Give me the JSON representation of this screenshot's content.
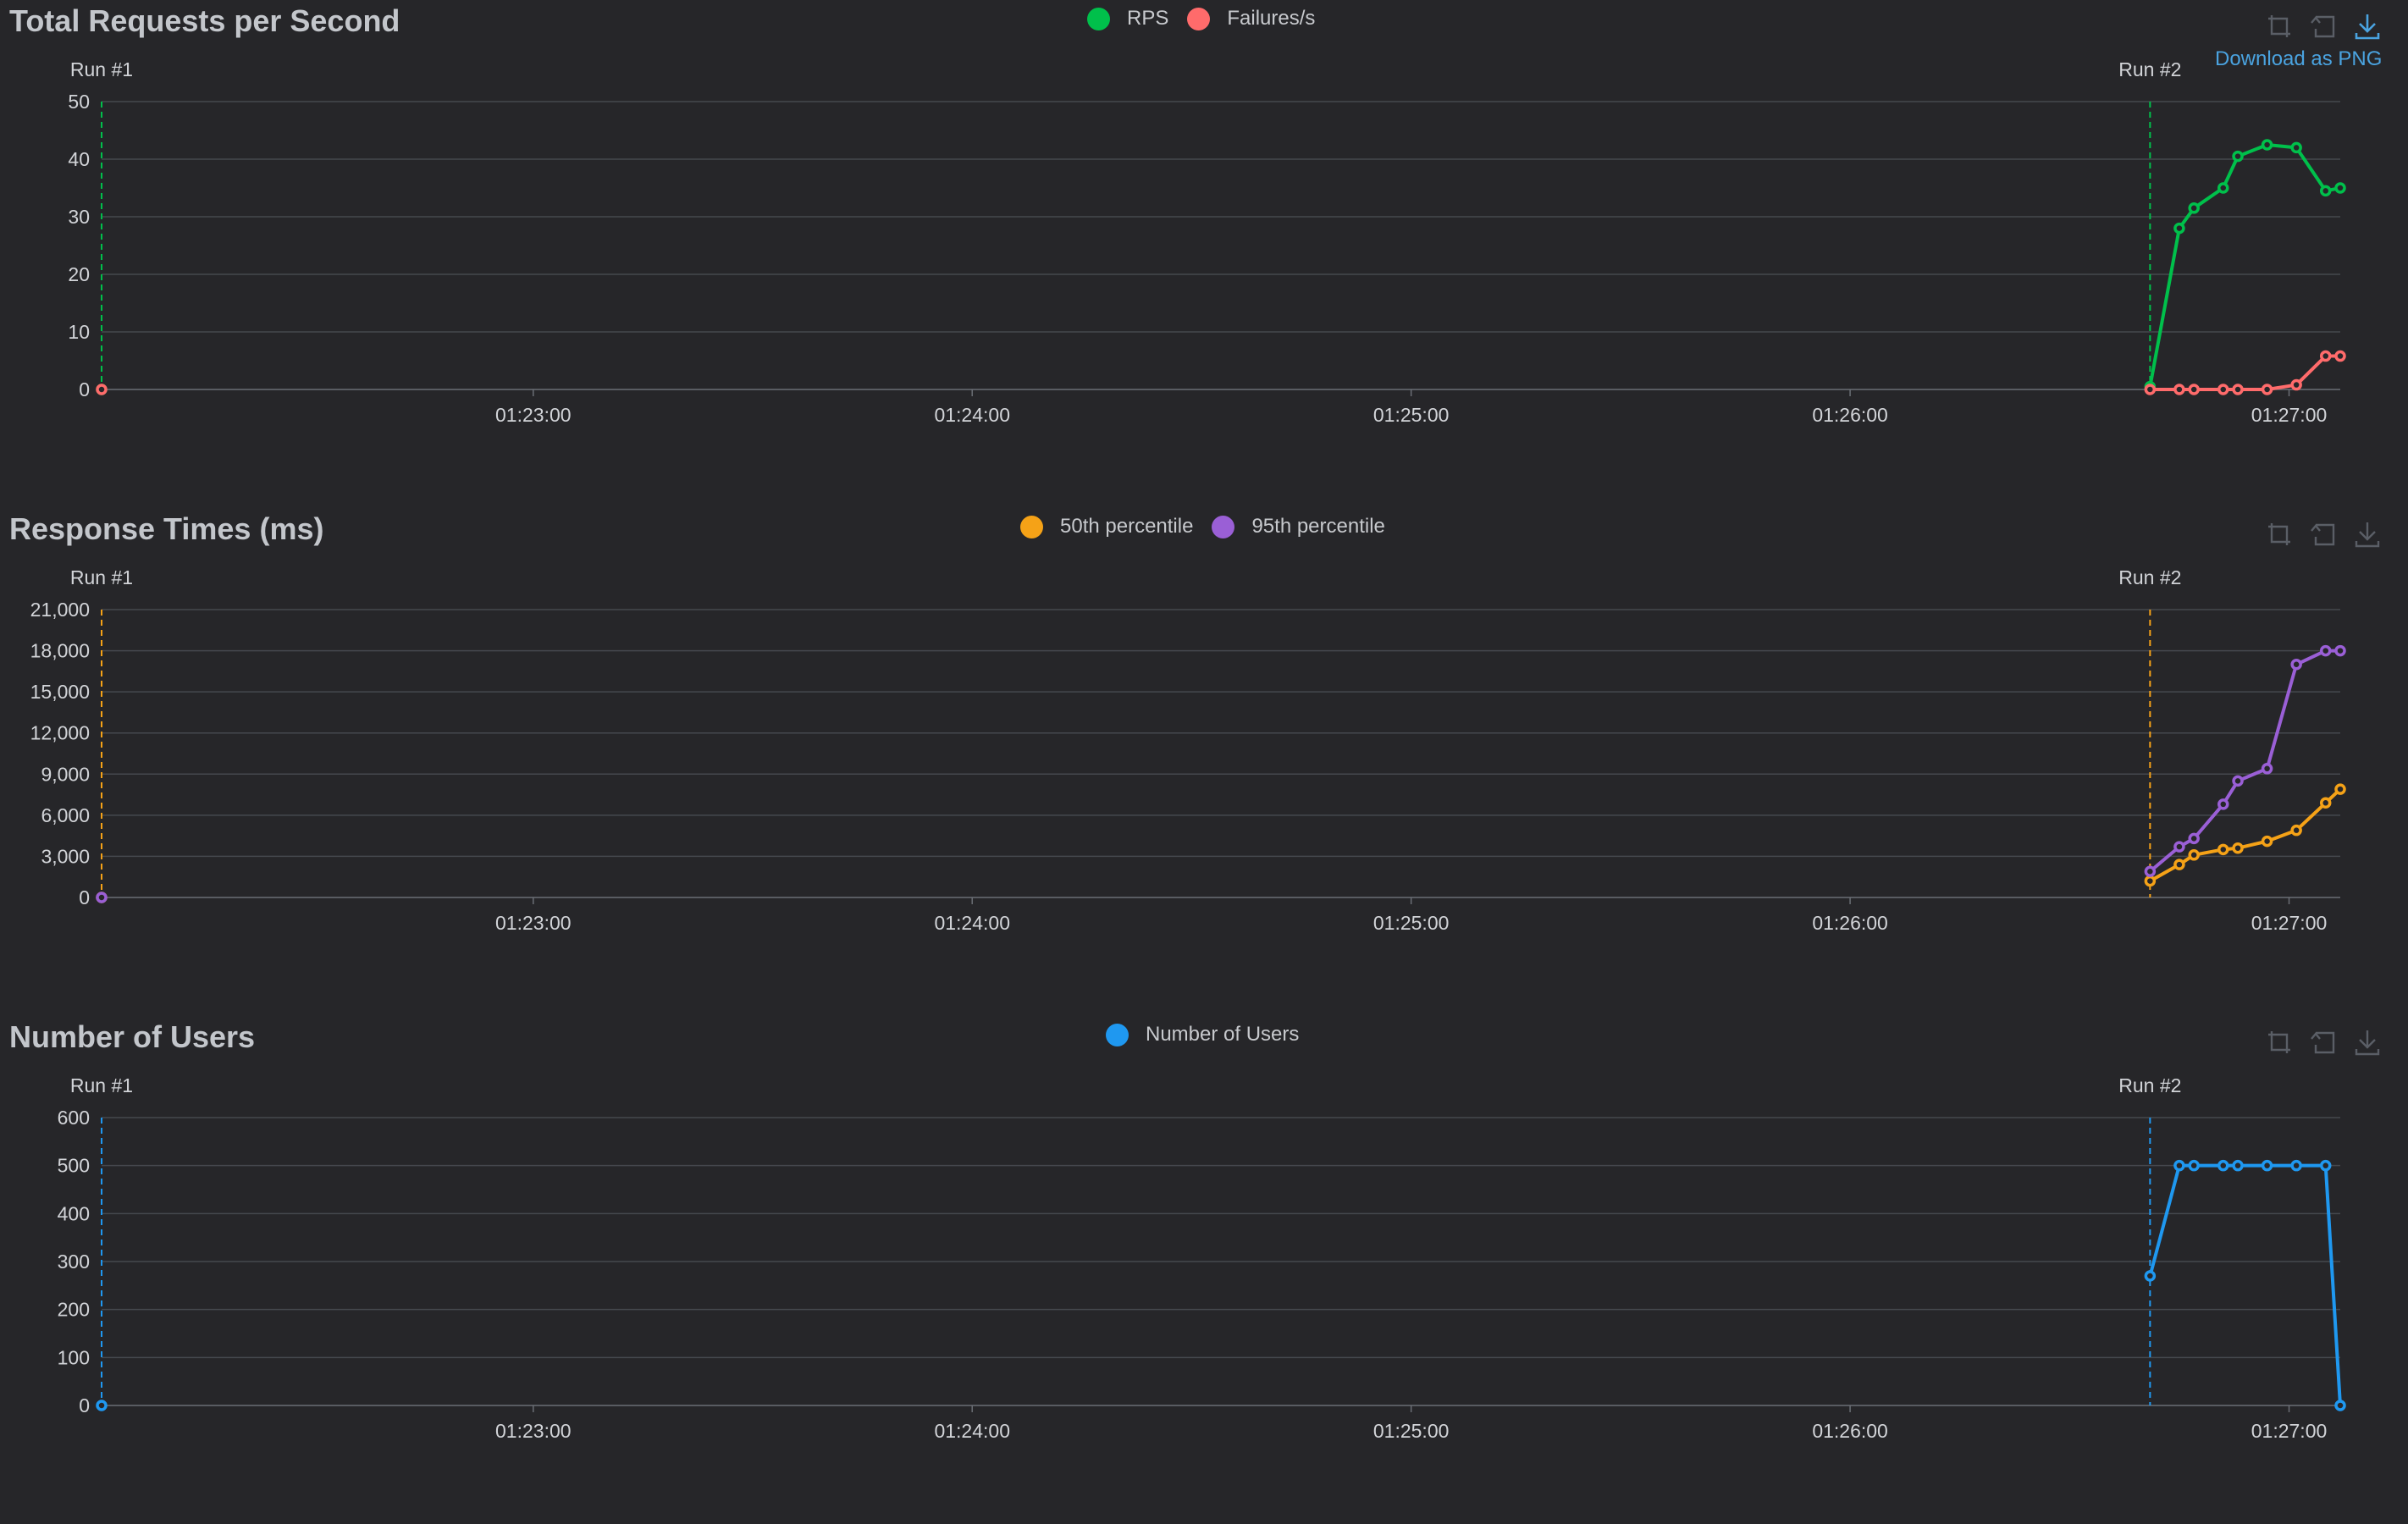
{
  "x_tick_labels": [
    "01:23:00",
    "01:24:00",
    "01:25:00",
    "01:26:00",
    "01:27:00"
  ],
  "download_tooltip": "Download as PNG",
  "charts": [
    {
      "id": "rps",
      "title": "Total Requests per Second",
      "legend": [
        {
          "name": "RPS",
          "color": "#00c04b"
        },
        {
          "name": "Failures/s",
          "color": "#ff6b6b"
        }
      ],
      "mark_lines": [
        "Run #1",
        "Run #2"
      ],
      "toolbox_icons": [
        "zoom-icon",
        "restore-icon",
        "download-icon"
      ]
    },
    {
      "id": "response",
      "title": "Response Times (ms)",
      "legend": [
        {
          "name": "50th percentile",
          "color": "#f5a217"
        },
        {
          "name": "95th percentile",
          "color": "#9a5fd6"
        }
      ],
      "mark_lines": [
        "Run #1",
        "Run #2"
      ],
      "toolbox_icons": [
        "zoom-icon",
        "restore-icon",
        "download-icon"
      ]
    },
    {
      "id": "users",
      "title": "Number of Users",
      "legend": [
        {
          "name": "Number of Users",
          "color": "#1f98f0"
        }
      ],
      "mark_lines": [
        "Run #1",
        "Run #2"
      ],
      "toolbox_icons": [
        "zoom-icon",
        "restore-icon",
        "download-icon"
      ]
    }
  ],
  "chart_data": [
    {
      "type": "line",
      "title": "Total Requests per Second",
      "xlabel": "",
      "ylabel": "",
      "x_ticks": [
        "01:23:00",
        "01:24:00",
        "01:25:00",
        "01:26:00",
        "01:27:00"
      ],
      "ylim": [
        0,
        50
      ],
      "y_ticks": [
        0,
        10,
        20,
        30,
        40,
        50
      ],
      "y_tick_labels": [
        "0",
        "10",
        "20",
        "30",
        "40",
        "50"
      ],
      "grid": true,
      "legend_position": "top-center",
      "run_markers": [
        {
          "label": "Run #1",
          "x": "01:22:01"
        },
        {
          "label": "Run #2",
          "x": "01:26:41"
        }
      ],
      "series": [
        {
          "name": "RPS",
          "color": "#00c04b",
          "x": [
            "01:22:01",
            "01:26:41",
            "01:26:45",
            "01:26:47",
            "01:26:51",
            "01:26:53",
            "01:26:57",
            "01:27:01",
            "01:27:05",
            "01:27:07"
          ],
          "values": [
            0,
            0.5,
            28,
            31.5,
            35,
            40.5,
            42.5,
            42,
            34.5,
            35
          ]
        },
        {
          "name": "Failures/s",
          "color": "#ff6b6b",
          "x": [
            "01:22:01",
            "01:26:41",
            "01:26:45",
            "01:26:47",
            "01:26:51",
            "01:26:53",
            "01:26:57",
            "01:27:01",
            "01:27:05",
            "01:27:07"
          ],
          "values": [
            0,
            0,
            0,
            0,
            0,
            0,
            0,
            0.8,
            5.8,
            5.8
          ]
        }
      ]
    },
    {
      "type": "line",
      "title": "Response Times (ms)",
      "xlabel": "",
      "ylabel": "",
      "x_ticks": [
        "01:23:00",
        "01:24:00",
        "01:25:00",
        "01:26:00",
        "01:27:00"
      ],
      "ylim": [
        0,
        21000
      ],
      "y_ticks": [
        0,
        3000,
        6000,
        9000,
        12000,
        15000,
        18000,
        21000
      ],
      "y_tick_labels": [
        "0",
        "3,000",
        "6,000",
        "9,000",
        "12,000",
        "15,000",
        "18,000",
        "21,000"
      ],
      "grid": true,
      "legend_position": "top-center",
      "run_markers": [
        {
          "label": "Run #1",
          "x": "01:22:01"
        },
        {
          "label": "Run #2",
          "x": "01:26:41"
        }
      ],
      "series": [
        {
          "name": "50th percentile",
          "color": "#f5a217",
          "x": [
            "01:22:01",
            "01:26:41",
            "01:26:45",
            "01:26:47",
            "01:26:51",
            "01:26:53",
            "01:26:57",
            "01:27:01",
            "01:27:05",
            "01:27:07"
          ],
          "values": [
            0,
            1200,
            2400,
            3100,
            3500,
            3600,
            4100,
            4900,
            6900,
            7900
          ]
        },
        {
          "name": "95th percentile",
          "color": "#9a5fd6",
          "x": [
            "01:22:01",
            "01:26:41",
            "01:26:45",
            "01:26:47",
            "01:26:51",
            "01:26:53",
            "01:26:57",
            "01:27:01",
            "01:27:05",
            "01:27:07"
          ],
          "values": [
            0,
            1900,
            3700,
            4300,
            6800,
            8500,
            9400,
            17000,
            18000,
            18000
          ]
        }
      ]
    },
    {
      "type": "line",
      "title": "Number of Users",
      "xlabel": "",
      "ylabel": "",
      "x_ticks": [
        "01:23:00",
        "01:24:00",
        "01:25:00",
        "01:26:00",
        "01:27:00"
      ],
      "ylim": [
        0,
        600
      ],
      "y_ticks": [
        0,
        100,
        200,
        300,
        400,
        500,
        600
      ],
      "y_tick_labels": [
        "0",
        "100",
        "200",
        "300",
        "400",
        "500",
        "600"
      ],
      "grid": true,
      "legend_position": "top-center",
      "run_markers": [
        {
          "label": "Run #1",
          "x": "01:22:01"
        },
        {
          "label": "Run #2",
          "x": "01:26:41"
        }
      ],
      "series": [
        {
          "name": "Number of Users",
          "color": "#1f98f0",
          "x": [
            "01:22:01",
            "01:26:41",
            "01:26:45",
            "01:26:47",
            "01:26:51",
            "01:26:53",
            "01:26:57",
            "01:27:01",
            "01:27:05",
            "01:27:07"
          ],
          "values": [
            0,
            270,
            500,
            500,
            500,
            500,
            500,
            500,
            500,
            0
          ]
        }
      ]
    }
  ]
}
